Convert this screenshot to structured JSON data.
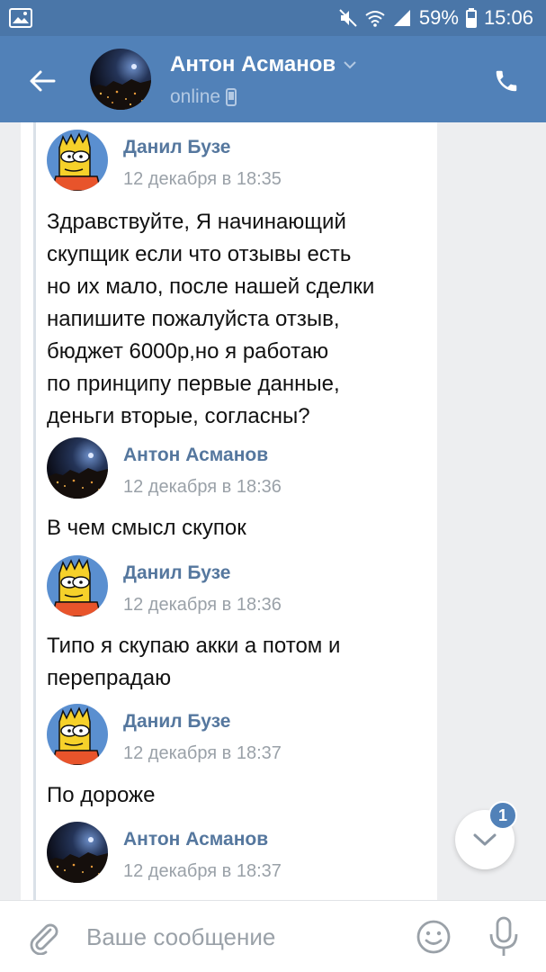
{
  "status_bar": {
    "battery": "59%",
    "time": "15:06",
    "icons": [
      "image-icon",
      "mute-icon",
      "wifi-icon",
      "signal-icon",
      "battery-icon"
    ]
  },
  "header": {
    "name": "Антон Асманов",
    "status": "online"
  },
  "messages": [
    {
      "author": "Данил Бузе",
      "date": "12 декабря в 18:35",
      "text": "Здравствуйте, Я начинающий\nскупщик если что отзывы есть\nно их мало, после нашей сделки\nнапишите пожалуйста отзыв,\nбюджет 6000р,но я работаю\nпо принципу первые данные,\nденьги вторые, согласны?"
    },
    {
      "author": "Антон Асманов",
      "date": "12 декабря в 18:36",
      "text": "В чем смысл скупок"
    },
    {
      "author": "Данил Бузе",
      "date": "12 декабря в 18:36",
      "text": "Типо я скупаю акки а потом и\nперепрадаю"
    },
    {
      "author": "Данил Бузе",
      "date": "12 декабря в 18:37",
      "text": "По дороже"
    },
    {
      "author": "Антон Асманов",
      "date": "12 декабря в 18:37",
      "text": ""
    }
  ],
  "scroll_badge": "1",
  "composer": {
    "placeholder": "Ваше сообщение"
  },
  "colors": {
    "header_bg": "#5181b8",
    "statusbar_bg": "#4a76a8",
    "author": "#55779e",
    "date": "#9aa1a8",
    "chat_bg": "#edeef0"
  }
}
